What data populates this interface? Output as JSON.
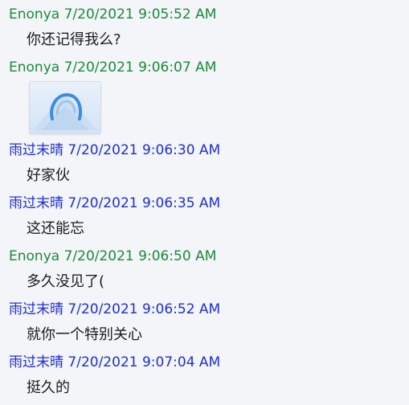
{
  "messages": [
    {
      "sender": "Enonya",
      "timestamp": "7/20/2021 9:05:52 AM",
      "text": "你还记得我么?"
    },
    {
      "sender": "Enonya",
      "timestamp": "7/20/2021 9:06:07 AM",
      "image": "sticker-image"
    },
    {
      "sender": "雨过末晴",
      "timestamp": "7/20/2021 9:06:30 AM",
      "text": "好家伙"
    },
    {
      "sender": "雨过末晴",
      "timestamp": "7/20/2021 9:06:35 AM",
      "text": "这还能忘"
    },
    {
      "sender": "Enonya",
      "timestamp": "7/20/2021 9:06:50 AM",
      "text": "多久没见了("
    },
    {
      "sender": "雨过末晴",
      "timestamp": "7/20/2021 9:06:52 AM",
      "text": "就你一个特别关心"
    },
    {
      "sender": "雨过末晴",
      "timestamp": "7/20/2021 9:07:04 AM",
      "text": "挺久的"
    }
  ],
  "colors": {
    "background": "#f3f5f8",
    "sender_enonya": "#1a8a3c",
    "sender_yuguo": "#1f2fd0",
    "message_text": "#1b1b1b"
  }
}
